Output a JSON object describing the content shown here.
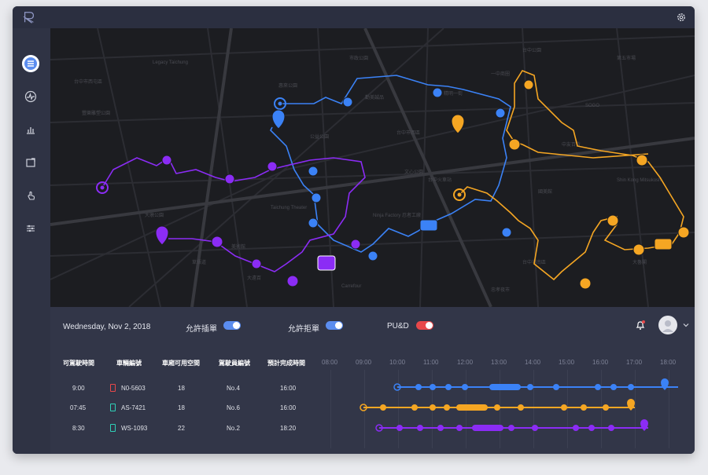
{
  "controls": {
    "date": "Wednesday, Nov 2, 2018",
    "toggle1_label": "允許插單",
    "toggle2_label": "允許拒單",
    "toggle3_label": "PU&D"
  },
  "table": {
    "headers": [
      "可駕駛時間",
      "車輛編號",
      "車廂可用空間",
      "駕駛員編號",
      "預計完成時間"
    ],
    "rows": [
      {
        "time": "9:00",
        "vehicle": "N0-5603",
        "space": "18",
        "driver": "No.4",
        "finish": "16:00",
        "color": "#e8484a"
      },
      {
        "time": "07:45",
        "vehicle": "AS-7421",
        "space": "18",
        "driver": "No.6",
        "finish": "16:00",
        "color": "#2fd0b8"
      },
      {
        "time": "8:30",
        "vehicle": "WS-1093",
        "space": "22",
        "driver": "No.2",
        "finish": "18:20",
        "color": "#2fd0b8"
      }
    ],
    "hours": [
      "08:00",
      "09:00",
      "10:00",
      "11:00",
      "12:00",
      "13:00",
      "14:00",
      "15:00",
      "16:00",
      "17:00",
      "18:00"
    ]
  },
  "map_labels": [
    "Legacy Taichung",
    "台中市西屯區",
    "惠來公園",
    "台中市西區",
    "市政公園",
    "台中市南區",
    "勤美誠品",
    "Ninja Factory 忍者工廠",
    "Taichung Theater",
    "大墩公園",
    "台中火車站",
    "精明一街",
    "Carrefour",
    "公益公園",
    "中友百貨",
    "第五市場",
    "SOGO",
    "大遠百",
    "國美館",
    "Shin Kong Mitsukoshi",
    "草悟道",
    "文心公園",
    "豐樂雕塑公園",
    "台中公園",
    "一中商圈",
    "美術館",
    "忠孝夜市",
    "大魯閣"
  ],
  "routes": {
    "blue": "#3b82f6",
    "orange": "#f5a623",
    "purple": "#8b2cf5"
  },
  "colors": {
    "app_bg": "#323648",
    "map_bg": "#1c1d21",
    "accent": "#5b8def",
    "toggle_red": "#e8484a"
  }
}
